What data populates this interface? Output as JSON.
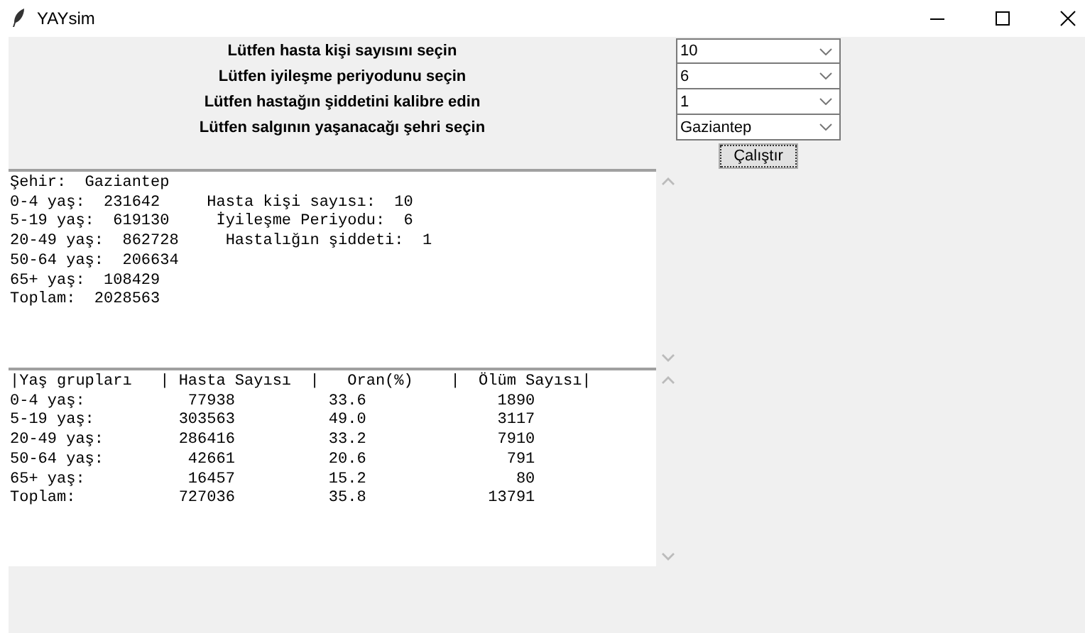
{
  "window": {
    "title": "YAYsim"
  },
  "form": {
    "fields": [
      {
        "label": "Lütfen hasta kişi sayısını seçin",
        "value": "10"
      },
      {
        "label": "Lütfen iyileşme periyodunu seçin",
        "value": "6"
      },
      {
        "label": "Lütfen hastağın şiddetini kalibre edin",
        "value": "1"
      },
      {
        "label": "Lütfen salgının yaşanacağı şehri seçin",
        "value": "Gaziantep"
      }
    ],
    "run_button": "Çalıştır"
  },
  "summary_text": [
    "Şehir:  Gaziantep",
    "0-4 yaş:  231642     Hasta kişi sayısı:  10",
    "5-19 yaş:  619130     İyileşme Periyodu:  6",
    "20-49 yaş:  862728     Hastalığın şiddeti:  1",
    "50-64 yaş:  206634",
    "65+ yaş:  108429",
    "Toplam:  2028563"
  ],
  "results_text": [
    "|Yaş grupları   | Hasta Sayısı  |   Oran(%)    |  Ölüm Sayısı|",
    "0-4 yaş:           77938          33.6              1890",
    "5-19 yaş:         303563          49.0              3117",
    "20-49 yaş:        286416          33.2              7910",
    "50-64 yaş:         42661          20.6               791",
    "65+ yaş:           16457          15.2                80",
    "Toplam:           727036          35.8             13791"
  ]
}
